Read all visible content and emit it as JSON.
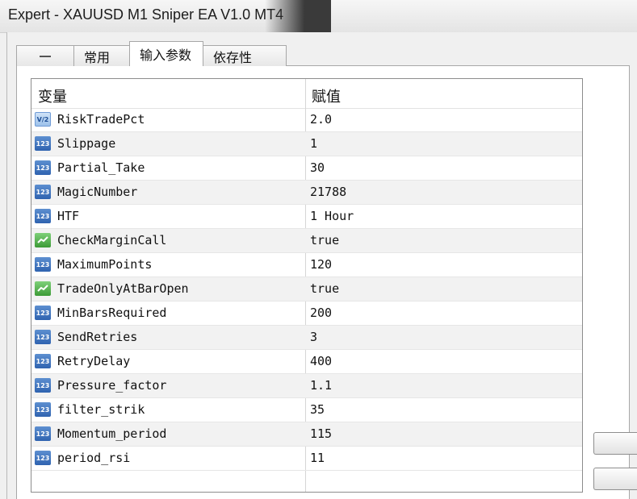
{
  "window": {
    "title": "Expert - XAUUSD M1 Sniper EA V1.0 MT4"
  },
  "tabs": [
    {
      "label": ""
    },
    {
      "label": "常用"
    },
    {
      "label": "输入参数"
    },
    {
      "label": "依存性"
    }
  ],
  "table": {
    "columns": [
      "变量",
      "赋值"
    ],
    "rows": [
      {
        "icon": "V/2",
        "name": "RiskTradePct",
        "value": "2.0"
      },
      {
        "icon": "123",
        "name": "Slippage",
        "value": "1"
      },
      {
        "icon": "123",
        "name": "Partial_Take",
        "value": "30"
      },
      {
        "icon": "123",
        "name": "MagicNumber",
        "value": "21788"
      },
      {
        "icon": "123",
        "name": "HTF",
        "value": "1 Hour"
      },
      {
        "icon": "bool",
        "name": "CheckMarginCall",
        "value": "true"
      },
      {
        "icon": "123",
        "name": "MaximumPoints",
        "value": "120"
      },
      {
        "icon": "bool",
        "name": "TradeOnlyAtBarOpen",
        "value": "true"
      },
      {
        "icon": "123",
        "name": "MinBarsRequired",
        "value": "200"
      },
      {
        "icon": "123",
        "name": "SendRetries",
        "value": "3"
      },
      {
        "icon": "123",
        "name": "RetryDelay",
        "value": "400"
      },
      {
        "icon": "123",
        "name": "Pressure_factor",
        "value": "1.1"
      },
      {
        "icon": "123",
        "name": "filter_strik",
        "value": "35"
      },
      {
        "icon": "123",
        "name": "Momentum_period",
        "value": "115"
      },
      {
        "icon": "123",
        "name": "period_rsi",
        "value": "11"
      }
    ]
  },
  "icons": {
    "int": "integer-param-icon",
    "double": "double-param-icon",
    "bool": "bool-param-icon"
  }
}
